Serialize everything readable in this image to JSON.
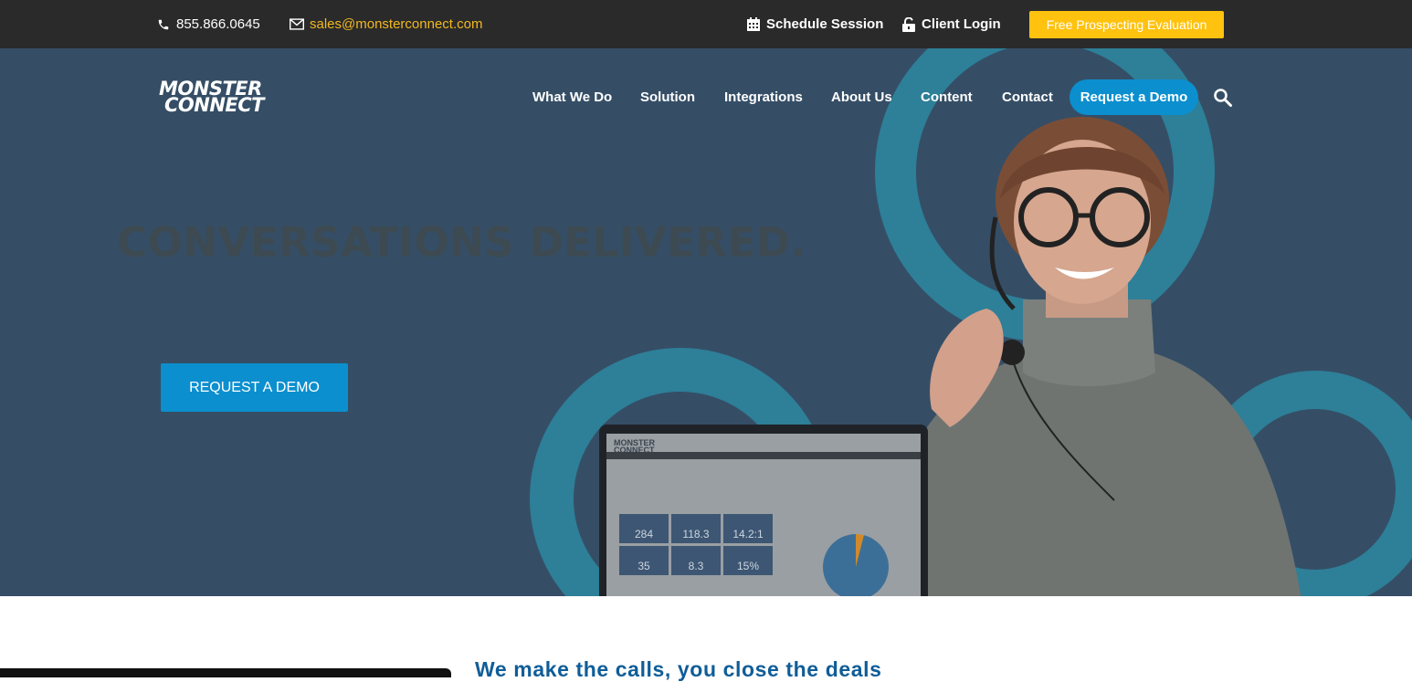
{
  "topbar": {
    "phone": "855.866.0645",
    "email": "sales@monsterconnect.com",
    "schedule": "Schedule Session",
    "login": "Client Login",
    "cta": "Free Prospecting Evaluation"
  },
  "header": {
    "logo_line1": "MONSTER",
    "logo_line2": "CONNECT",
    "nav": [
      "What We Do",
      "Solution",
      "Integrations",
      "About Us",
      "Content",
      "Contact"
    ],
    "cta": "Request a Demo"
  },
  "hero": {
    "headline": "CONVERSATIONS DELIVERED.",
    "cta": "REQUEST A DEMO",
    "screen_logo_line1": "MONSTER",
    "screen_logo_line2": "CONNECT",
    "tiles": [
      "284",
      "118.3",
      "14.2:1",
      "35",
      "8.3",
      "15%"
    ]
  },
  "section": {
    "heading": "We make the calls, you close the deals"
  },
  "colors": {
    "topbar_bg": "#2a2a2a",
    "hero_bg": "#354e66",
    "accent_blue": "#0b8fcf",
    "accent_yellow": "#ffc20e",
    "heading_blue": "#0f5d98"
  }
}
